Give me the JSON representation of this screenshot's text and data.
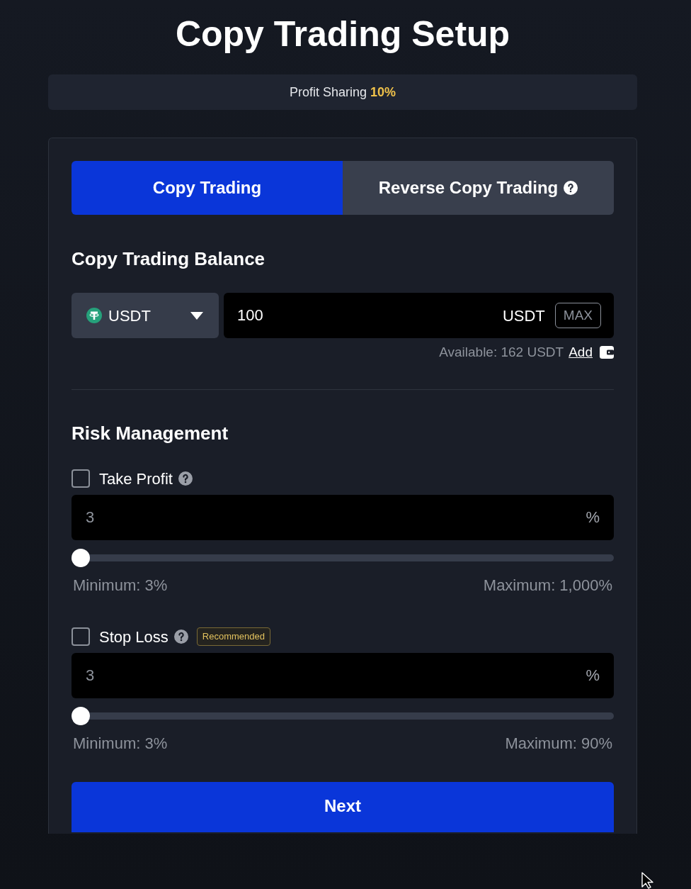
{
  "title": "Copy Trading Setup",
  "profit_sharing": "Profit Sharing **10%**",
  "tabs": [
    {
      "label": "Copy Trading",
      "selected": true,
      "help": false
    },
    {
      "label": "Reverse Copy Trading",
      "selected": false,
      "help": true
    }
  ],
  "balance": {
    "heading": "Copy Trading Balance",
    "currency": "USDT",
    "amount": "100",
    "unit": "USDT",
    "max_button": "MAX",
    "available": "Available: 162 USDT",
    "add_link": "Add"
  },
  "risk": {
    "heading": "Risk Management",
    "items": [
      {
        "label": "Take Profit",
        "checked": false,
        "help": true,
        "placeholder": "3",
        "unit": "%",
        "level": 0,
        "minimum": "Minimum: 3%",
        "maximum": "Maximum: 1,000%"
      },
      {
        "label": "Stop Loss",
        "checked": false,
        "help": true,
        "badge": "Recommended",
        "placeholder": "3",
        "unit": "%",
        "level": 0,
        "minimum": "Minimum: 3%",
        "maximum": "Maximum: 90%"
      }
    ]
  },
  "next_button": "Next"
}
